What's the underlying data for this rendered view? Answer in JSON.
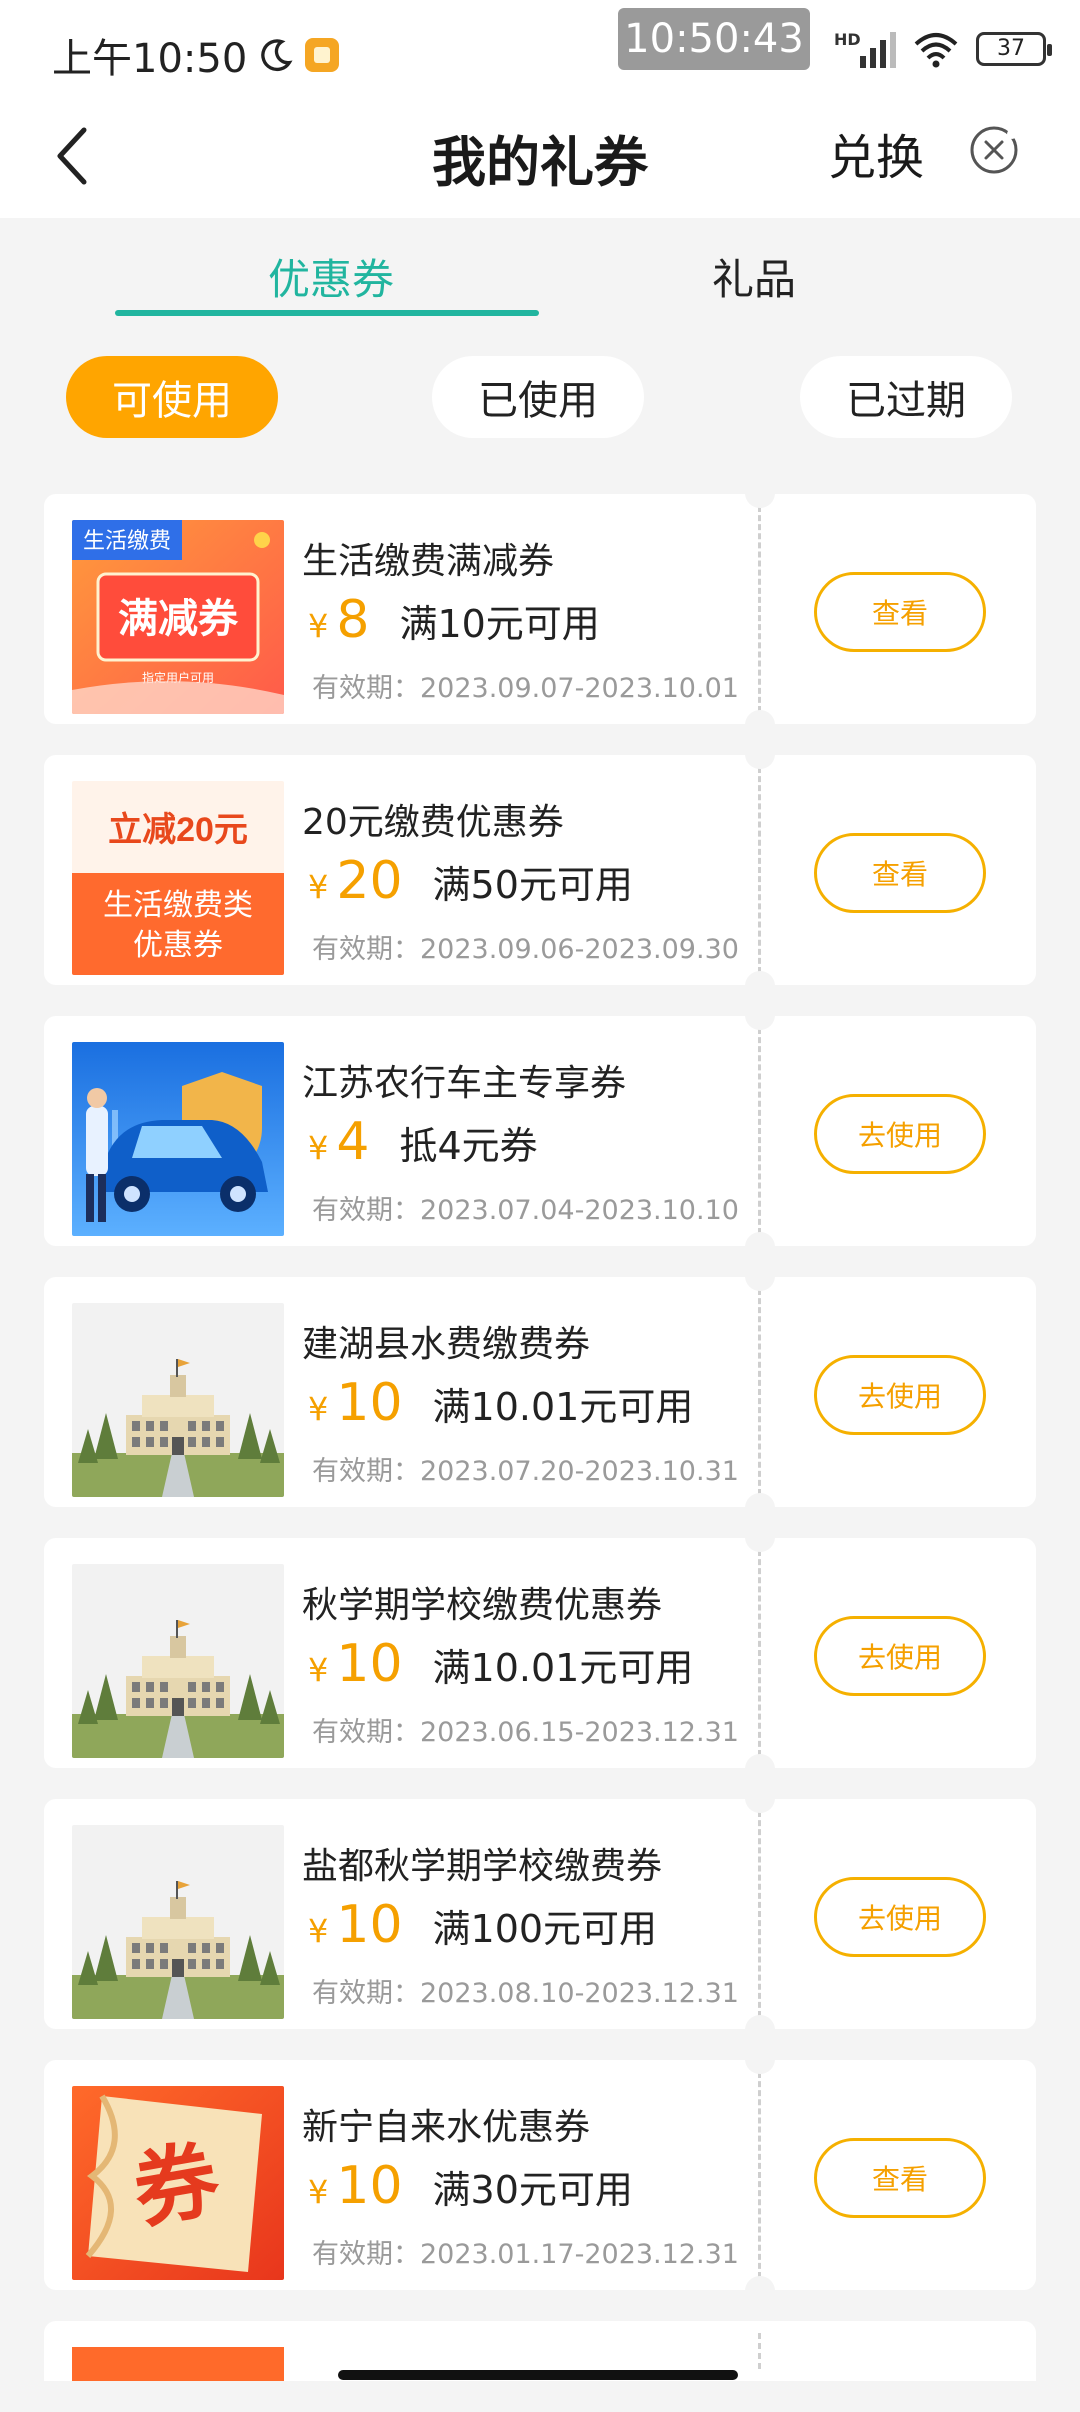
{
  "status_bar": {
    "time": "上午10:50",
    "clock_overlay": "10:50:43",
    "network": "HD",
    "battery": "37"
  },
  "header": {
    "title": "我的礼券",
    "exchange_label": "兑换"
  },
  "tabs": [
    {
      "label": "优惠券",
      "active": true
    },
    {
      "label": "礼品",
      "active": false
    }
  ],
  "filters": [
    {
      "label": "可使用",
      "active": true
    },
    {
      "label": "已使用",
      "active": false
    },
    {
      "label": "已过期",
      "active": false
    }
  ],
  "coupons": [
    {
      "title": "生活缴费满减券",
      "currency": "¥",
      "amount": "8",
      "condition": "满10元可用",
      "validity": "有效期：2023.09.07-2023.10.01",
      "action": "查看",
      "image": "life-payment-discount",
      "image_texts": [
        "生活缴费",
        "满减券",
        "指定用户可用"
      ]
    },
    {
      "title": "20元缴费优惠券",
      "currency": "¥",
      "amount": "20",
      "condition": "满50元可用",
      "validity": "有效期：2023.09.06-2023.09.30",
      "action": "查看",
      "image": "instant-discount",
      "image_texts": [
        "立减20元",
        "生活缴费类",
        "优惠券"
      ]
    },
    {
      "title": "江苏农行车主专享券",
      "currency": "¥",
      "amount": "4",
      "condition": "抵4元券",
      "validity": "有效期：2023.07.04-2023.10.10",
      "action": "去使用",
      "image": "car-owner"
    },
    {
      "title": "建湖县水费缴费券",
      "currency": "¥",
      "amount": "10",
      "condition": "满10.01元可用",
      "validity": "有效期：2023.07.20-2023.10.31",
      "action": "去使用",
      "image": "school-building"
    },
    {
      "title": "秋学期学校缴费优惠券",
      "currency": "¥",
      "amount": "10",
      "condition": "满10.01元可用",
      "validity": "有效期：2023.06.15-2023.12.31",
      "action": "去使用",
      "image": "school-building"
    },
    {
      "title": "盐都秋学期学校缴费券",
      "currency": "¥",
      "amount": "10",
      "condition": "满100元可用",
      "validity": "有效期：2023.08.10-2023.12.31",
      "action": "去使用",
      "image": "school-building"
    },
    {
      "title": "新宁自来水优惠券",
      "currency": "¥",
      "amount": "10",
      "condition": "满30元可用",
      "validity": "有效期：2023.01.17-2023.12.31",
      "action": "查看",
      "image": "coupon-ticket",
      "image_texts": [
        "券"
      ]
    }
  ],
  "colors": {
    "accent_green": "#21b59f",
    "accent_orange": "#ffa500",
    "price_orange": "#f5a000"
  }
}
